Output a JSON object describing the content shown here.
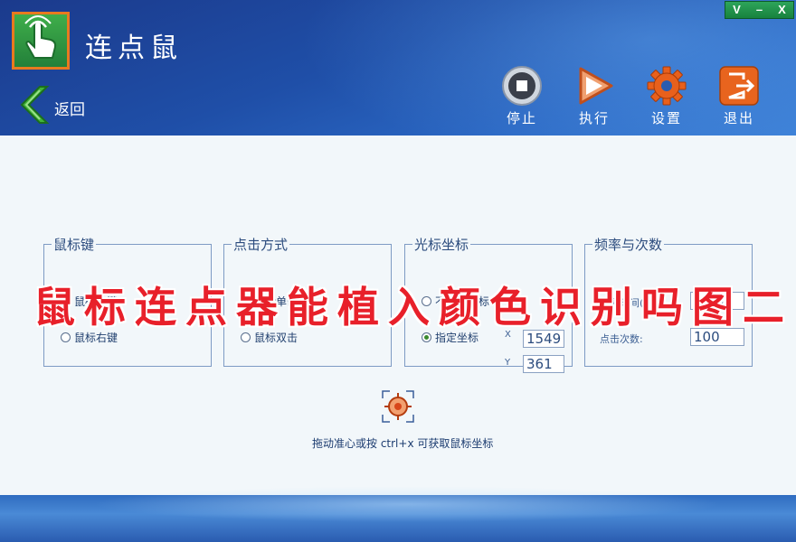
{
  "window": {
    "title": "连点鼠",
    "controls": [
      "V",
      "–",
      "X"
    ]
  },
  "nav": {
    "back_label": "返回"
  },
  "toolbar": [
    {
      "label": "停止",
      "icon": "stop-icon"
    },
    {
      "label": "执行",
      "icon": "play-icon"
    },
    {
      "label": "设置",
      "icon": "gear-icon"
    },
    {
      "label": "退出",
      "icon": "exit-icon"
    }
  ],
  "groups": {
    "mouse_button": {
      "title": "鼠标键",
      "options": [
        {
          "label": "鼠标左键",
          "selected": true
        },
        {
          "label": "鼠标右键",
          "selected": false
        }
      ]
    },
    "click_mode": {
      "title": "点击方式",
      "options": [
        {
          "label": "鼠标单击",
          "selected": true
        },
        {
          "label": "鼠标双击",
          "selected": false
        }
      ]
    },
    "cursor_coord": {
      "title": "光标坐标",
      "options": [
        {
          "label": "不指定坐标",
          "selected": false
        },
        {
          "label": "指定坐标",
          "selected": true
        }
      ],
      "x_label": "X",
      "x_value": "1549",
      "y_label": "Y",
      "y_value": "361"
    },
    "frequency": {
      "title": "频率与次数",
      "interval_label": "间隔时间(秒)",
      "interval_value": "0.001",
      "count_label": "点击次数:",
      "count_value": "100"
    }
  },
  "crosshair_hint": "拖动准心或按 ctrl+x 可获取鼠标坐标",
  "watermark": "鼠标连点器能植入颜色识别吗图二",
  "colors": {
    "header": "#1f4fa8",
    "logo_green": "#2f9a44",
    "logo_border": "#e87a1f",
    "watermark": "#e8202a",
    "radio_selected": "#3a8a2e"
  }
}
